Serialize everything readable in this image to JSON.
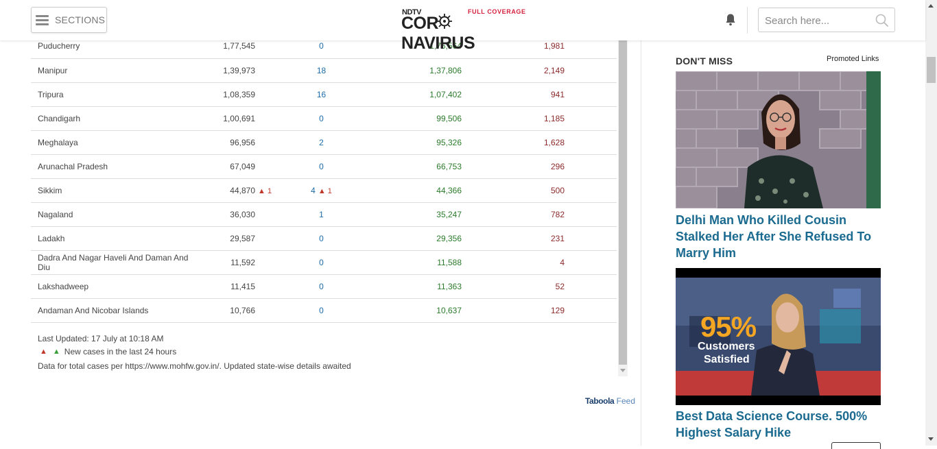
{
  "header": {
    "sections_label": "SECTIONS",
    "logo": {
      "ndtv": "NDTV",
      "full_coverage": "FULL COVERAGE",
      "word_left": "COR",
      "word_right": "NAVIRUS"
    },
    "search_placeholder": "Search here..."
  },
  "table": {
    "rows": [
      {
        "state": "Puducherry",
        "confirmed": "1,77,545",
        "active": "0",
        "recovered": "1,75,564",
        "deaths": "1,981"
      },
      {
        "state": "Manipur",
        "confirmed": "1,39,973",
        "active": "18",
        "recovered": "1,37,806",
        "deaths": "2,149"
      },
      {
        "state": "Tripura",
        "confirmed": "1,08,359",
        "active": "16",
        "recovered": "1,07,402",
        "deaths": "941"
      },
      {
        "state": "Chandigarh",
        "confirmed": "1,00,691",
        "active": "0",
        "recovered": "99,506",
        "deaths": "1,185"
      },
      {
        "state": "Meghalaya",
        "confirmed": "96,956",
        "active": "2",
        "recovered": "95,326",
        "deaths": "1,628"
      },
      {
        "state": "Arunachal Pradesh",
        "confirmed": "67,049",
        "active": "0",
        "recovered": "66,753",
        "deaths": "296"
      },
      {
        "state": "Sikkim",
        "confirmed": "44,870",
        "confirmed_inc": "▲ 1",
        "active": "4",
        "active_inc": "▲ 1",
        "recovered": "44,366",
        "deaths": "500"
      },
      {
        "state": "Nagaland",
        "confirmed": "36,030",
        "active": "1",
        "recovered": "35,247",
        "deaths": "782"
      },
      {
        "state": "Ladakh",
        "confirmed": "29,587",
        "active": "0",
        "recovered": "29,356",
        "deaths": "231"
      },
      {
        "state": "Dadra And Nagar Haveli And Daman And Diu",
        "confirmed": "11,592",
        "active": "0",
        "recovered": "11,588",
        "deaths": "4"
      },
      {
        "state": "Lakshadweep",
        "confirmed": "11,415",
        "active": "0",
        "recovered": "11,363",
        "deaths": "52"
      },
      {
        "state": "Andaman And Nicobar Islands",
        "confirmed": "10,766",
        "active": "0",
        "recovered": "10,637",
        "deaths": "129"
      }
    ]
  },
  "footnotes": {
    "last_updated": "Last Updated: 17 July at 10:18 AM",
    "legend_red": "▲",
    "legend_green": "▲",
    "legend_text": "New cases in the last 24 hours",
    "source": "Data for total cases per https://www.mohfw.gov.in/. Updated state-wise details awaited"
  },
  "taboola": {
    "brand": "Taboola",
    "feed": "Feed"
  },
  "sidebar": {
    "heading": "DON'T MISS",
    "promoted": "Promoted Links",
    "cards": [
      {
        "title": "Delhi Man Who Killed Cousin Stalked Her After She Refused To Marry Him"
      },
      {
        "title": "Best Data Science Course. 500% Highest Salary Hike",
        "image_text_big": "95%",
        "image_text_line1": "Customers",
        "image_text_line2": "Satisfied"
      }
    ]
  },
  "colors": {
    "active": "#1c6ba8",
    "recovered": "#2b7a2b",
    "deaths": "#8b2a2a",
    "increase": "#c0392b",
    "headline": "#1b6a8f"
  }
}
